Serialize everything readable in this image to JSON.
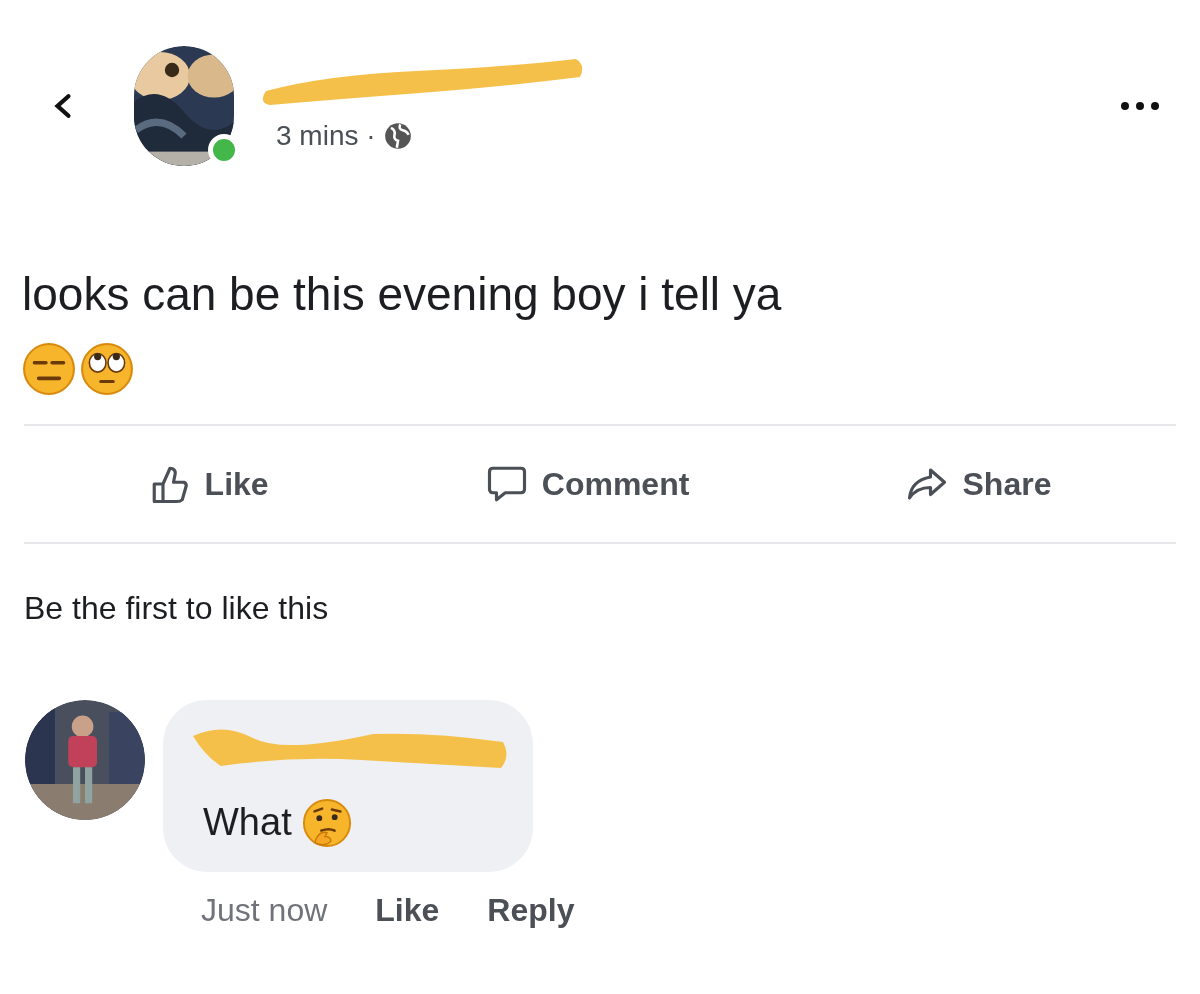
{
  "post": {
    "author": {
      "online": true
    },
    "time": "3 mins ·",
    "text": "looks can be this evening boy i tell ya",
    "emojis": [
      {
        "kind": "expressionless"
      },
      {
        "kind": "eye-roll"
      }
    ]
  },
  "actions": [
    {
      "kind": "like",
      "label": "Like"
    },
    {
      "kind": "comment",
      "label": "Comment"
    },
    {
      "kind": "share",
      "label": "Share"
    }
  ],
  "likes_summary": "Be the first to like this",
  "comment": {
    "text": "What",
    "emoji": {
      "kind": "thinking"
    },
    "time": "Just now",
    "actions": [
      "Like",
      "Reply"
    ]
  }
}
